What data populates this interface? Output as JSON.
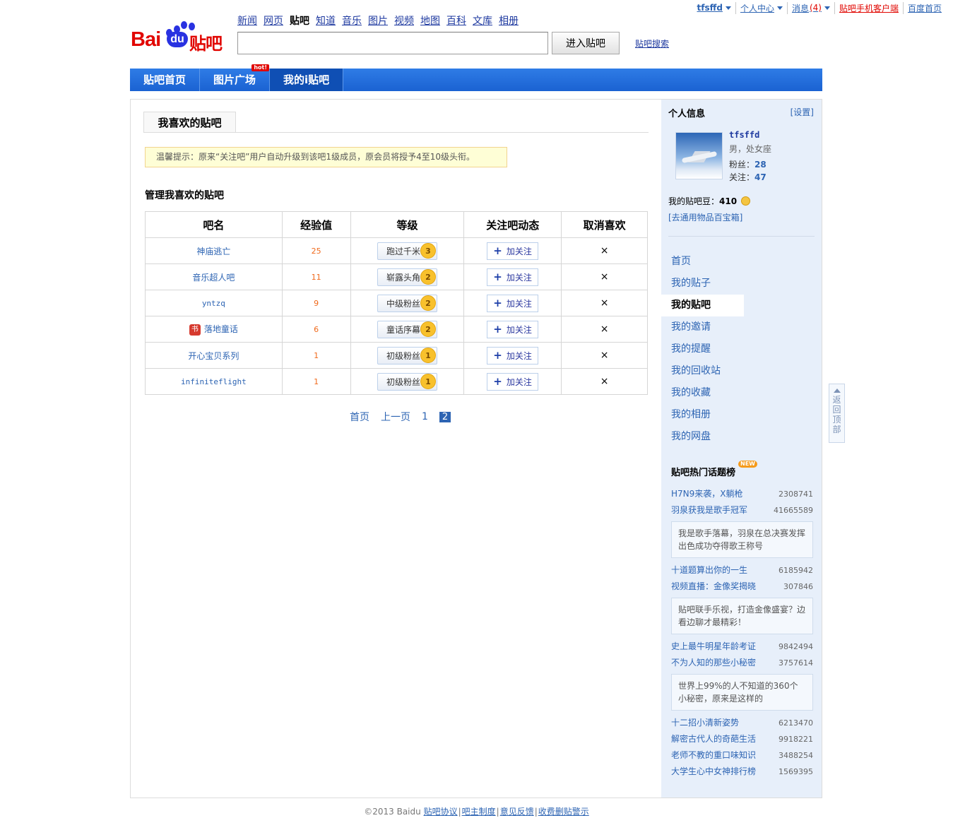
{
  "userbar": {
    "username": "tfsffd",
    "personal_center": "个人中心",
    "messages": "消息",
    "message_count": "(4)",
    "mobile_client": "贴吧手机客户端",
    "baidu_home": "百度首页"
  },
  "logo": {
    "bai": "Bai",
    "du": "du",
    "tieba": "贴吧"
  },
  "product_nav": [
    "新闻",
    "网页",
    "贴吧",
    "知道",
    "音乐",
    "图片",
    "视频",
    "地图",
    "百科",
    "文库",
    "相册"
  ],
  "product_nav_current": "贴吧",
  "search": {
    "value": "",
    "button": "进入贴吧",
    "link": "贴吧搜索"
  },
  "main_nav": {
    "items": [
      "贴吧首页",
      "图片广场",
      "我的i贴吧"
    ],
    "hot_badge": "hot!"
  },
  "tab": "我喜欢的贴吧",
  "tip": "温馨提示：原来“关注吧”用户自动升级到该吧1级成员，原会员将授予4至10级头衔。",
  "manage_title": "管理我喜欢的贴吧",
  "table": {
    "headers": [
      "吧名",
      "经验值",
      "等级",
      "关注吧动态",
      "取消喜欢"
    ],
    "follow_label": "加关注",
    "remove_symbol": "×",
    "rows": [
      {
        "name": "神庙逃亡",
        "exp": "25",
        "level_title": "跑过千米",
        "level": "3",
        "icon": ""
      },
      {
        "name": "音乐超人吧",
        "exp": "11",
        "level_title": "崭露头角",
        "level": "2",
        "icon": ""
      },
      {
        "name": "yntzq",
        "exp": "9",
        "level_title": "中级粉丝",
        "level": "2",
        "icon": ""
      },
      {
        "name": "落地童话",
        "exp": "6",
        "level_title": "童话序幕",
        "level": "2",
        "icon": "书"
      },
      {
        "name": "开心宝贝系列",
        "exp": "1",
        "level_title": "初级粉丝",
        "level": "1",
        "icon": ""
      },
      {
        "name": "infiniteflight",
        "exp": "1",
        "level_title": "初级粉丝",
        "level": "1",
        "icon": ""
      }
    ]
  },
  "pager": {
    "first": "首页",
    "prev": "上一页",
    "page1": "1",
    "current": "2"
  },
  "profile": {
    "title": "个人信息",
    "settings": "[设置]",
    "username": "tfsffd",
    "gender_constellation": "男，处女座",
    "fans_label": "粉丝：",
    "fans": "28",
    "follow_label": "关注：",
    "follow": "47",
    "beans_label": "我的贴吧豆：",
    "beans": "410",
    "treasure_link": "[去通用物品百宝箱]"
  },
  "side_menu": [
    "首页",
    "我的贴子",
    "我的贴吧",
    "我的邀请",
    "我的提醒",
    "我的回收站",
    "我的收藏",
    "我的相册",
    "我的网盘"
  ],
  "side_menu_current": "我的贴吧",
  "hot_topics": {
    "title": "贴吧热门话题榜",
    "new_badge": "NEW",
    "groups": [
      {
        "items": [
          {
            "title": "H7N9来袭，X躺枪",
            "count": "2308741"
          },
          {
            "title": "羽泉获我是歌手冠军",
            "count": "41665589"
          }
        ],
        "desc": "我是歌手落幕，羽泉在总决赛发挥出色成功夺得歌王称号"
      },
      {
        "items": [
          {
            "title": "十道题算出你的一生",
            "count": "6185942"
          },
          {
            "title": "视频直播：金像奖揭晓",
            "count": "307846"
          }
        ],
        "desc": "贴吧联手乐视，打造金像盛宴？边看边聊才最精彩！"
      },
      {
        "items": [
          {
            "title": "史上最牛明星年龄考证",
            "count": "9842494"
          },
          {
            "title": "不为人知的那些小秘密",
            "count": "3757614"
          }
        ],
        "desc": "世界上99%的人不知道的360个小秘密，原来是这样的"
      },
      {
        "items": [
          {
            "title": "十二招小清新姿势",
            "count": "6213470"
          },
          {
            "title": "解密古代人的奇葩生活",
            "count": "9918221"
          },
          {
            "title": "老师不教的重口味知识",
            "count": "3488254"
          },
          {
            "title": "大学生心中女神排行榜",
            "count": "1569395"
          }
        ],
        "desc": ""
      }
    ]
  },
  "back_to_top": [
    "返",
    "回",
    "顶",
    "部"
  ],
  "footer": {
    "copyright": "©2013 Baidu",
    "links": [
      "贴吧协议",
      "吧主制度",
      "意见反馈",
      "收费删贴警示"
    ]
  },
  "colors": {
    "brand_blue": "#2f7ce6",
    "link_blue": "#2d64b3",
    "brand_red": "#e10601",
    "exp_orange": "#f06a1c",
    "sidebar_bg": "#e7effa"
  }
}
